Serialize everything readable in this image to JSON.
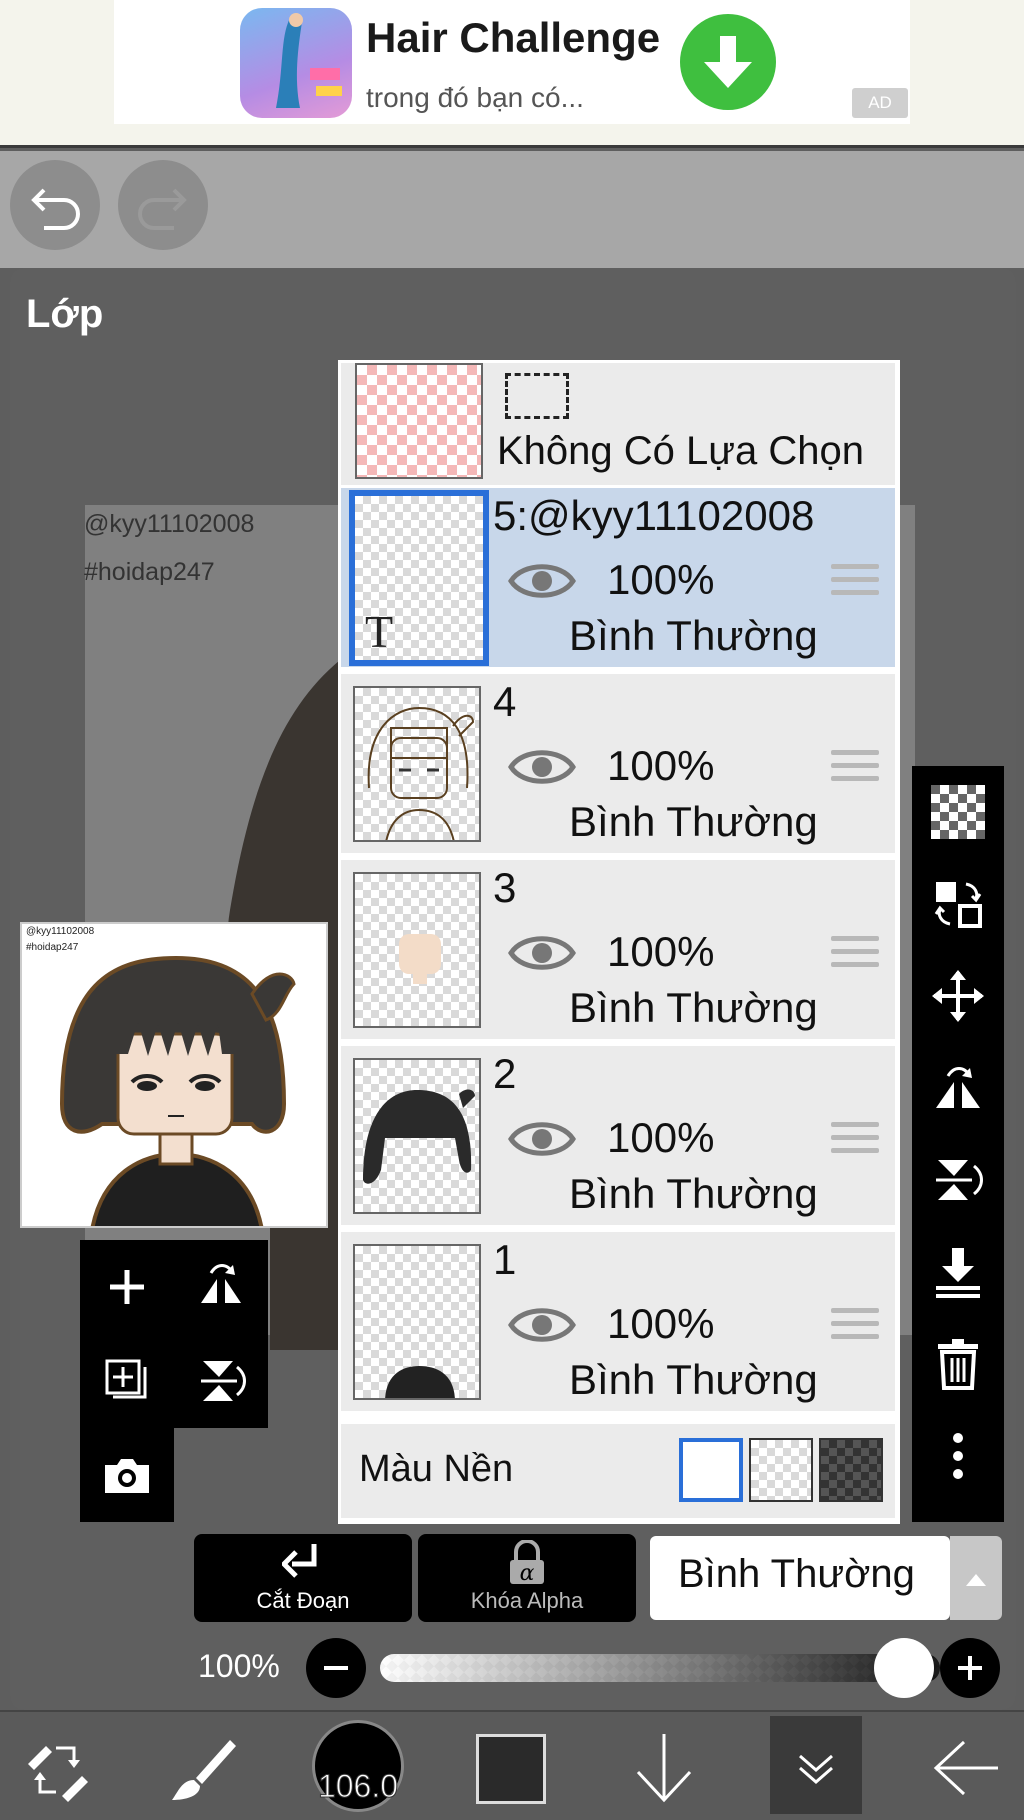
{
  "ad": {
    "title": "Hair Challenge",
    "subtitle": "trong đó bạn có...",
    "badge": "AD"
  },
  "panel": {
    "title": "Lớp"
  },
  "canvas": {
    "watermark_line1": "@kyy11102008",
    "watermark_line2": "#hoidap247"
  },
  "preview": {
    "watermark_line1": "@kyy11102008",
    "watermark_line2": "#hoidap247"
  },
  "selection_row": {
    "label": "Không Có Lựa Chọn"
  },
  "layers": [
    {
      "name": "5:@kyy11102008",
      "opacity": "100%",
      "blend": "Bình Thường",
      "selected": true,
      "thumb_letter": "T"
    },
    {
      "name": "4",
      "opacity": "100%",
      "blend": "Bình Thường",
      "selected": false
    },
    {
      "name": "3",
      "opacity": "100%",
      "blend": "Bình Thường",
      "selected": false
    },
    {
      "name": "2",
      "opacity": "100%",
      "blend": "Bình Thường",
      "selected": false
    },
    {
      "name": "1",
      "opacity": "100%",
      "blend": "Bình Thường",
      "selected": false
    }
  ],
  "background": {
    "label": "Màu Nền",
    "options": [
      "white",
      "transparent",
      "dark-checker"
    ],
    "selected": "white"
  },
  "bottom_controls": {
    "clip_label": "Cắt Đoạn",
    "alpha_lock_label": "Khóa Alpha",
    "blend_mode": "Bình Thường",
    "opacity_label": "100%",
    "opacity_value": 1.0
  },
  "toolbar": {
    "brush_size": "106.0",
    "color": "#2a2a2a"
  },
  "colors": {
    "selected_border": "#2a6fd8",
    "selected_row": "#c8d7ea",
    "ad_download": "#3fbf3f"
  }
}
